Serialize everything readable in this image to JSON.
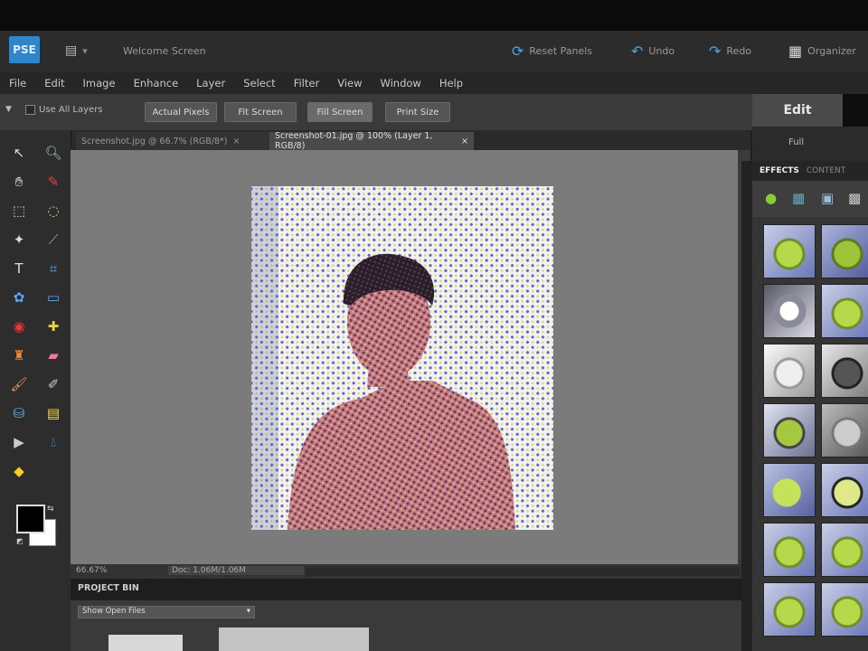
{
  "app": {
    "logo_text": "PSE",
    "title": "Welcome Screen",
    "reset_panels": "Reset Panels",
    "undo": "Undo",
    "redo": "Redo",
    "organizer": "Organizer"
  },
  "menu": [
    "File",
    "Edit",
    "Image",
    "Enhance",
    "Layer",
    "Select",
    "Filter",
    "View",
    "Window",
    "Help"
  ],
  "options": {
    "checkbox_label": "Use All Layers",
    "buttons": [
      "Actual Pixels",
      "Fit Screen",
      "Fill Screen",
      "Print Size"
    ]
  },
  "doc_tabs": [
    {
      "label": "Screenshot.jpg @ 66.7% (RGB/8*)",
      "close": "×"
    },
    {
      "label": "Screenshot-01.jpg @ 100% (Layer 1, RGB/8)",
      "close": "×"
    }
  ],
  "status": {
    "zoom": "66.67%",
    "doc_info": "Doc: 1.06M/1.06M"
  },
  "project_bin": {
    "title": "PROJECT BIN",
    "dropdown": "Show Open Files"
  },
  "right_panel": {
    "edit_tab": "Edit",
    "full_label": "Full",
    "tabs": [
      "EFFECTS",
      "CONTENT"
    ]
  },
  "colors": {
    "accent": "#2f86c9",
    "canvas": "#7b7b7b",
    "panel": "#353535"
  },
  "icons": [
    "undo-icon",
    "redo-icon",
    "organizer-icon",
    "reset-panels-icon"
  ]
}
